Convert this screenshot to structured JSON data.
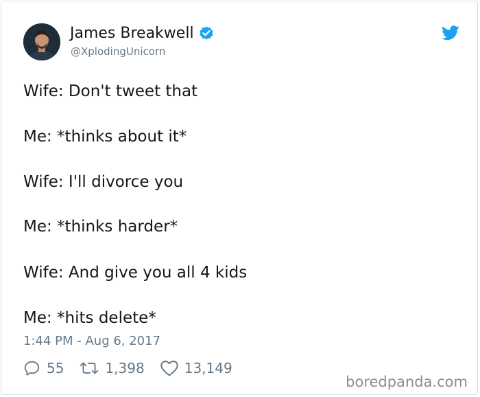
{
  "author": {
    "display_name": "James Breakwell",
    "handle": "@XplodingUnicorn",
    "verified": true
  },
  "tweet": {
    "lines": [
      "Wife: Don't tweet that",
      "Me: *thinks about it*",
      "Wife: I'll divorce you",
      "Me: *thinks harder*",
      "Wife: And give you all 4 kids",
      "Me: *hits delete*"
    ],
    "timestamp": "1:44 PM - Aug 6, 2017"
  },
  "actions": {
    "replies": "55",
    "retweets": "1,398",
    "likes": "13,149"
  },
  "watermark": "boredpanda.com",
  "colors": {
    "text": "#14171a",
    "secondary": "#657786",
    "twitter_blue": "#1da1f2",
    "watermark": "#8c8c8c"
  }
}
